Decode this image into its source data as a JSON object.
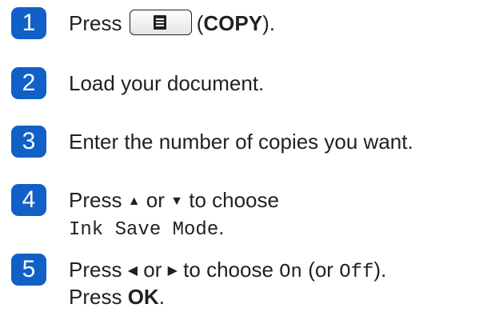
{
  "steps": [
    {
      "number": "1",
      "press": "Press",
      "key_icon": "copy-document-icon",
      "paren_open": "(",
      "key_name": "COPY",
      "paren_close": ")."
    },
    {
      "number": "2",
      "text": "Load your document."
    },
    {
      "number": "3",
      "text": "Enter the number of copies you want."
    },
    {
      "number": "4",
      "press": "Press",
      "up_arrow": "▲",
      "or": "or",
      "down_arrow": "▼",
      "to_choose": "to choose",
      "setting": "Ink Save Mode",
      "period": "."
    },
    {
      "number": "5",
      "press": "Press",
      "left_arrow": "◀",
      "or": "or",
      "right_arrow": "▶",
      "to_choose": "to choose",
      "option_on": "On",
      "paren_or": "(or",
      "option_off": "Off",
      "paren_close": ").",
      "press2": "Press",
      "ok": "OK",
      "period": "."
    }
  ],
  "colors": {
    "badge": "#1060c8",
    "text": "#231f20"
  }
}
